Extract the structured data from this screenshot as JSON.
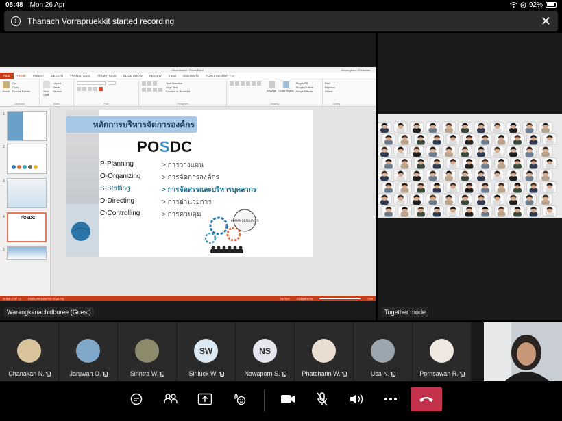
{
  "status_bar": {
    "time": "08:48",
    "date": "Mon 26 Apr",
    "battery": "92%"
  },
  "banner": {
    "message": "Thanach Vorrapruekkit started recording"
  },
  "presenter": {
    "label": "Warangkanachidburee (Guest)"
  },
  "together": {
    "label": "Together mode"
  },
  "ppt": {
    "window_title": "Recruitment - PowerPoint",
    "account": "Warangkana Chidburee",
    "tabs": [
      "FILE",
      "HOME",
      "INSERT",
      "DESIGN",
      "TRANSITIONS",
      "ANIMATIONS",
      "SLIDE SHOW",
      "REVIEW",
      "VIEW",
      "DocuWorks",
      "FOXIT READER PDF"
    ],
    "groups": [
      "Clipboard",
      "Slides",
      "Font",
      "Paragraph",
      "Drawing",
      "Editing"
    ],
    "clipboard_items": [
      "Cut",
      "Copy",
      "Format Painter"
    ],
    "paste_label": "Paste",
    "slides_items": [
      "Layout",
      "Reset",
      "Section"
    ],
    "new_slide_label": "New Slide",
    "paragraph_items": [
      "Text Direction",
      "Align Text",
      "Convert to SmartArt"
    ],
    "drawing_items": [
      "Shape Fill",
      "Shape Outline",
      "Shape Effects"
    ],
    "arrange_label": "Arrange",
    "quick_styles_label": "Quick Styles",
    "editing_items": [
      "Find",
      "Replace",
      "Select"
    ],
    "statusbar": {
      "slide": "SLIDE 4 OF 13",
      "language": "ENGLISH (UNITED STATES)",
      "notes": "NOTES",
      "comments": "COMMENTS",
      "zoom": "74%"
    }
  },
  "slide": {
    "heading": "หลักการบริหารจัดการองค์กร",
    "title": {
      "p1": "PO",
      "s": "S",
      "p2": "DC"
    },
    "rows": [
      {
        "left": "P-Planning",
        "right": "> การวางแผน"
      },
      {
        "left": "O-Organizing",
        "right": "> การจัดการองค์กร"
      },
      {
        "left": "S-Staffing",
        "right": "> การจัดสรรและบริหารบุคลากร"
      },
      {
        "left": "D-Directing",
        "right": "> การอำนวยการ"
      },
      {
        "left": "C-Controlling",
        "right": "> การควบคุม"
      }
    ],
    "graphic_text": "HUMAN RESOURCES"
  },
  "participants": [
    {
      "name": "Chanakan N.",
      "initials": "",
      "color": "#d8c39a"
    },
    {
      "name": "Jaruwan O.",
      "initials": "",
      "color": "#7fa7c9"
    },
    {
      "name": "Sirintra W.",
      "initials": "",
      "color": "#8c8a6a"
    },
    {
      "name": "Siriluck W.",
      "initials": "SW",
      "color": "#dce8f2"
    },
    {
      "name": "Nawaporn S.",
      "initials": "NS",
      "color": "#e4e4ee"
    },
    {
      "name": "Phatcharin W.",
      "initials": "",
      "color": "#e9ddd2"
    },
    {
      "name": "Usa N.",
      "initials": "",
      "color": "#9aa5ae"
    },
    {
      "name": "Pornsawan R.",
      "initials": "",
      "color": "#efe9e2"
    }
  ],
  "colors": {
    "hangup": "#c4314b",
    "ppt_accent": "#c43e1c"
  },
  "controls": [
    "chat-icon",
    "people-icon",
    "share-tray-icon",
    "reactions-icon",
    "camera-icon",
    "mic-off-icon",
    "speaker-icon",
    "more-icon",
    "hang-up-icon"
  ]
}
